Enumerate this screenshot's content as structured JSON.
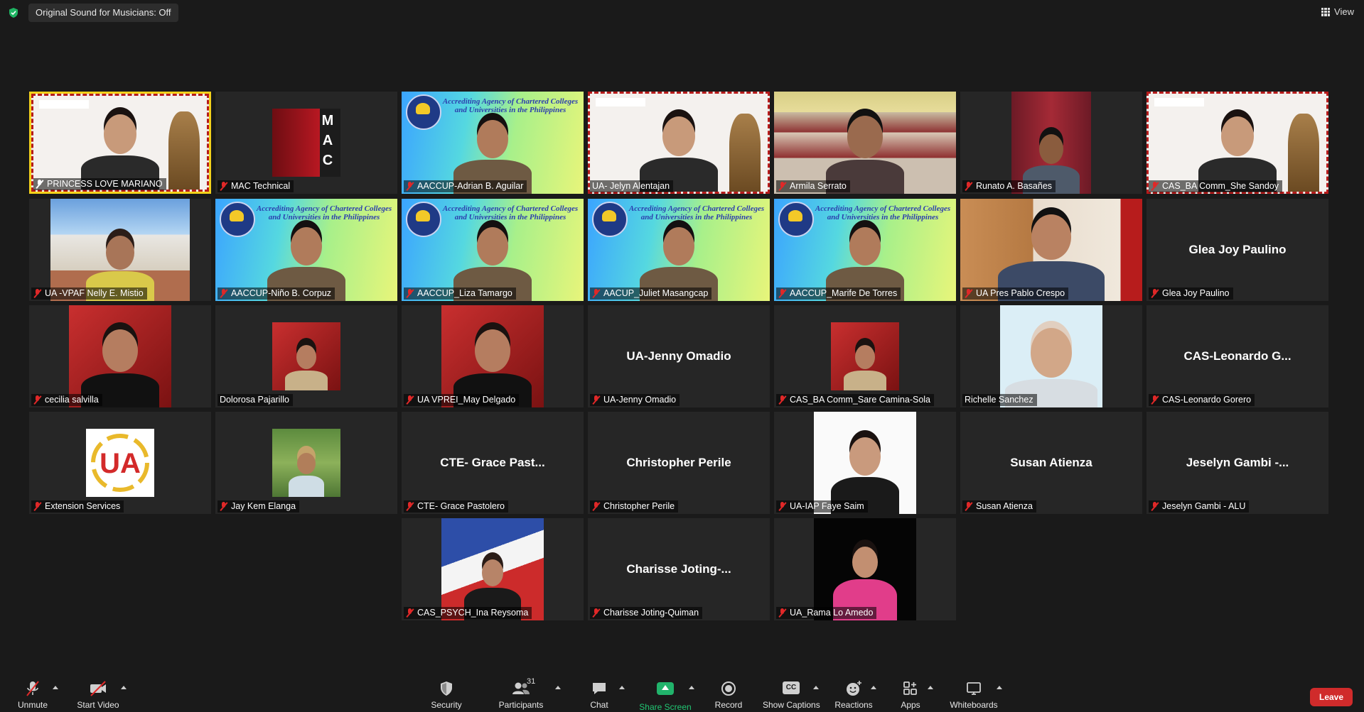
{
  "topbar": {
    "original_sound_label": "Original Sound for Musicians: Off",
    "view_label": "View"
  },
  "tiles": [
    {
      "name": "PRINCESS LOVE MARIANO",
      "muted": false,
      "bg": "ua"
    },
    {
      "name": "MAC Technical",
      "muted": true,
      "bg": "mac"
    },
    {
      "name": "AACCUP-Adrian B. Aguilar",
      "muted": true,
      "bg": "aaccup"
    },
    {
      "name": "UA- Jelyn Alentajan",
      "muted": false,
      "bg": "ua"
    },
    {
      "name": "Armila Serrato",
      "muted": true,
      "bg": "office"
    },
    {
      "name": "Runato A. Basañes",
      "muted": true,
      "bg": "curtain"
    },
    {
      "name": "CAS_BA Comm_She Sandoy",
      "muted": true,
      "bg": "ua"
    },
    {
      "name": "UA -VPAF Nelly E. Mistio",
      "muted": true,
      "bg": "campus"
    },
    {
      "name": "AACCUP-Niño B. Corpuz",
      "muted": true,
      "bg": "aaccup"
    },
    {
      "name": "AACCUP_Liza Tamargo",
      "muted": true,
      "bg": "aaccup"
    },
    {
      "name": "AACUP_Juliet Masangcap",
      "muted": true,
      "bg": "aaccup"
    },
    {
      "name": "AACCUP_Marife De Torres",
      "muted": true,
      "bg": "aaccup"
    },
    {
      "name": "UA Pres Pablo Crespo",
      "muted": true,
      "bg": "office2"
    },
    {
      "name": "Glea Joy Paulino",
      "muted": true,
      "bg": "none",
      "display_name": "Glea Joy Paulino"
    },
    {
      "name": "cecilia salvilla",
      "muted": true,
      "bg": "red"
    },
    {
      "name": "Dolorosa Pajarillo",
      "muted": false,
      "bg": "redsmall"
    },
    {
      "name": "UA VPREI_May Delgado",
      "muted": true,
      "bg": "red"
    },
    {
      "name": "UA-Jenny Omadio",
      "muted": true,
      "bg": "none",
      "display_name": "UA-Jenny Omadio"
    },
    {
      "name": "CAS_BA Comm_Sare Camina-Sola",
      "muted": true,
      "bg": "redsmall"
    },
    {
      "name": "Richelle Sanchez",
      "muted": false,
      "bg": "idphoto"
    },
    {
      "name": "CAS-Leonardo Gorero",
      "muted": true,
      "bg": "none",
      "display_name": "CAS-Leonardo  G..."
    },
    {
      "name": "Extension Services",
      "muted": true,
      "bg": "ualogo"
    },
    {
      "name": "Jay Kem Elanga",
      "muted": true,
      "bg": "outdoor"
    },
    {
      "name": "CTE- Grace Pastolero",
      "muted": true,
      "bg": "none",
      "display_name": "CTE- Grace Past..."
    },
    {
      "name": "Christopher Perile",
      "muted": true,
      "bg": "none",
      "display_name": "Christopher Perile"
    },
    {
      "name": "UA-IAP Faye Saim",
      "muted": true,
      "bg": "white"
    },
    {
      "name": "Susan Atienza",
      "muted": true,
      "bg": "none",
      "display_name": "Susan Atienza"
    },
    {
      "name": "Jeselyn Gambi - ALU",
      "muted": true,
      "bg": "none",
      "display_name": "Jeselyn Gambi  -..."
    },
    {
      "name": "CAS_PSYCH_Ina Reysoma",
      "muted": true,
      "bg": "flag"
    },
    {
      "name": "Charisse Joting-Quiman",
      "muted": true,
      "bg": "none",
      "display_name": "Charisse  Joting-..."
    },
    {
      "name": "UA_Rama Lo Amedo",
      "muted": true,
      "bg": "black"
    }
  ],
  "aaccup_banner": "Accrediting Agency of Chartered Colleges and Universities in the Philippines",
  "mac_letters": [
    "M",
    "A",
    "C"
  ],
  "toolbar": {
    "unmute": "Unmute",
    "start_video": "Start Video",
    "security": "Security",
    "participants": "Participants",
    "participants_count": "31",
    "chat": "Chat",
    "share_screen": "Share Screen",
    "record": "Record",
    "show_captions": "Show Captions",
    "captions_badge": "CC",
    "reactions": "Reactions",
    "apps": "Apps",
    "whiteboards": "Whiteboards",
    "leave": "Leave"
  },
  "colors": {
    "active_speaker": "#f4d21b",
    "muted_red": "#e02828",
    "share_green": "#21b36b",
    "leave_red": "#d02b2b"
  }
}
